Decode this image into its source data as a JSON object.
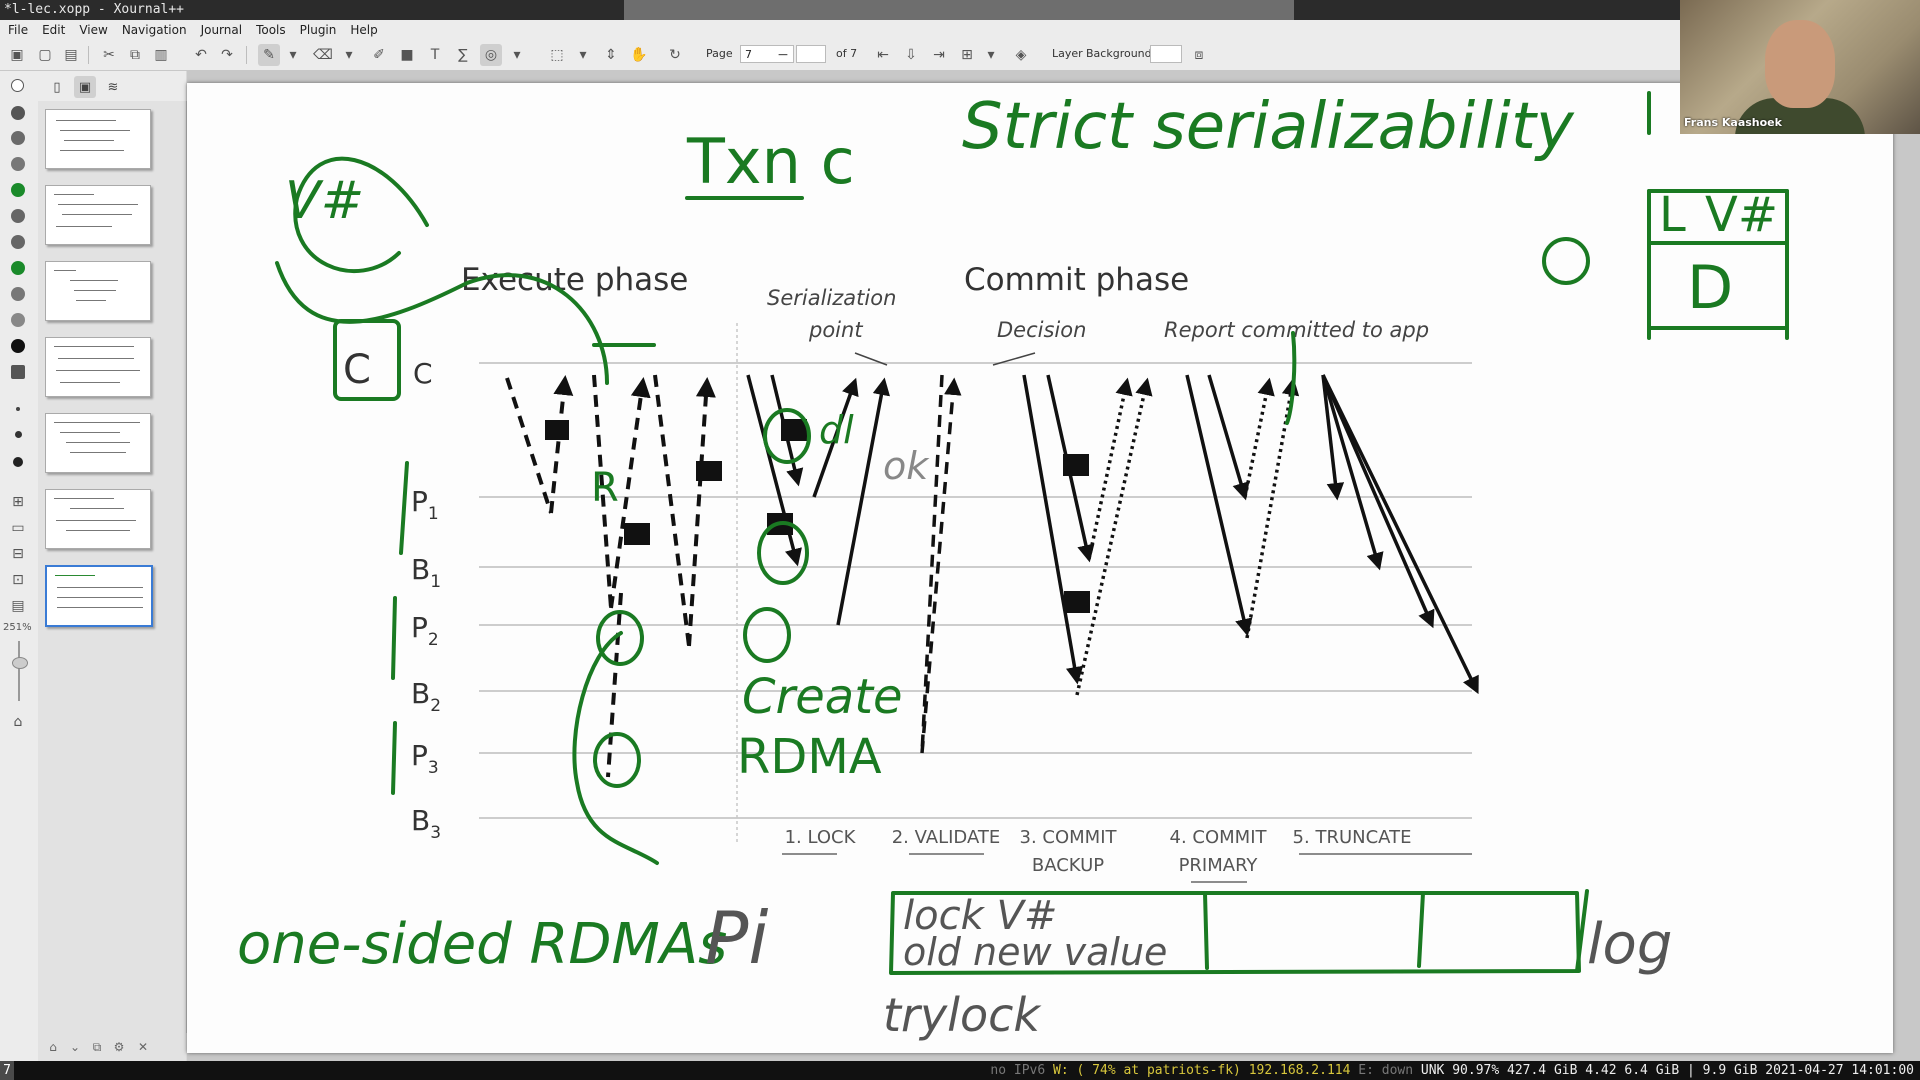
{
  "window": {
    "title": "*l-lec.xopp - Xournal++"
  },
  "menu": [
    "File",
    "Edit",
    "View",
    "Navigation",
    "Journal",
    "Tools",
    "Plugin",
    "Help"
  ],
  "toolbar": {
    "page_label": "Page",
    "page_value": "7",
    "page_of": "of 7",
    "layer_label": "Layer",
    "layer_value": "Background"
  },
  "sidebar": {
    "zoom": "251%"
  },
  "webcam": {
    "name": "Frans Kaashoek"
  },
  "slide": {
    "execute_phase": "Execute phase",
    "commit_phase": "Commit phase",
    "serialization_point_1": "Serialization",
    "serialization_point_2": "point",
    "decision": "Decision",
    "report": "Report committed to app",
    "rows": [
      {
        "main": "C",
        "sub": ""
      },
      {
        "main": "P",
        "sub": "1"
      },
      {
        "main": "B",
        "sub": "1"
      },
      {
        "main": "P",
        "sub": "2"
      },
      {
        "main": "B",
        "sub": "2"
      },
      {
        "main": "P",
        "sub": "3"
      },
      {
        "main": "B",
        "sub": "3"
      }
    ],
    "steps": [
      {
        "l1": "1. LOCK",
        "l2": ""
      },
      {
        "l1": "2. VALIDATE",
        "l2": ""
      },
      {
        "l1": "3. COMMIT",
        "l2": "BACKUP"
      },
      {
        "l1": "4. COMMIT",
        "l2": "PRIMARY"
      },
      {
        "l1": "5. TRUNCATE",
        "l2": ""
      }
    ]
  },
  "ink": {
    "title_strict": "Strict serializability",
    "txn": "Txn c",
    "vhash": "V#",
    "box_l": "L",
    "box_v": "V#",
    "box_d": "D",
    "dl": "dl",
    "ok": "ok",
    "r": "R",
    "create": "Create",
    "rdma": "RDMA",
    "one_sided": "one-sided RDMAs",
    "pi": "Pi",
    "lock_vhash": "lock V#",
    "old_new": "old new value",
    "trylock": "trylock",
    "log": "log",
    "colors": {
      "green_ink": "#1a7a22",
      "gray_ink": "#555555"
    }
  },
  "statusbar": {
    "workspace": "7",
    "ipv6": "no IPv6",
    "wifi": "W: ( 74% at patriots-fk) 192.168.2.114",
    "eth": "E: down",
    "rest": "UNK 90.97% 427.4 GiB 4.42 6.4 GiB | 9.9 GiB 2021-04-27 14:01:00"
  }
}
